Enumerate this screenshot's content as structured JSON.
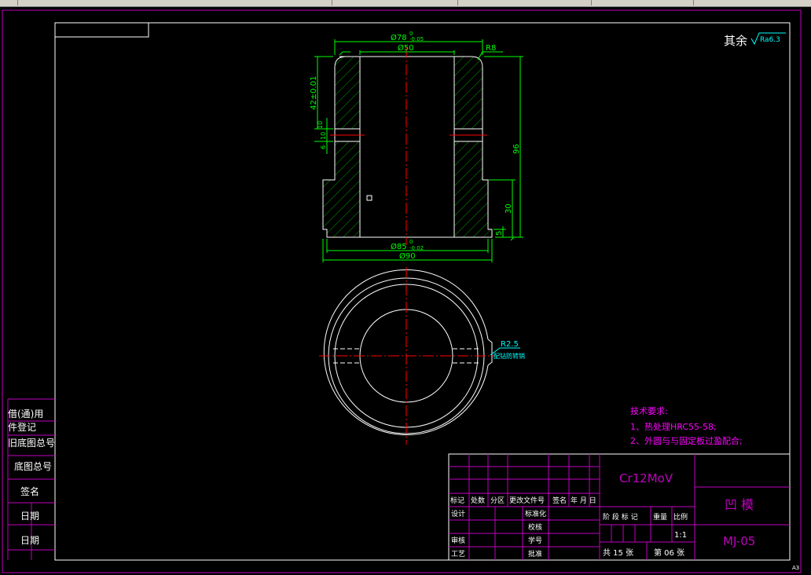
{
  "colors": {
    "background": "#000000",
    "frame": "#ffffff",
    "dimension": "#00ff00",
    "centerline": "#ff0000",
    "hatch": "#00b000",
    "title_block": "#c000c0",
    "notes": "#ff00ff",
    "annotation_cyan": "#00ffff"
  },
  "surface_finish_note": {
    "label": "其余",
    "roughness": "Ra6.3"
  },
  "front_view": {
    "dims": {
      "outer_top_base": "Ø78",
      "outer_top_upper": "0",
      "outer_top_lower": "-0.05",
      "inner": "Ø50",
      "fillet": "R8",
      "height_42": "42±0.01",
      "groove_dim_a": "6",
      "groove_dim_b": "10",
      "groove_dim_c": "10",
      "height_96": "96",
      "height_30": "30",
      "flange": "5",
      "bottom_base": "Ø85",
      "bottom_upper": "0",
      "bottom_lower": "-0.02",
      "overall": "Ø90"
    }
  },
  "top_view": {
    "radius_label": "R2.5",
    "pin_note": "配钻防转销"
  },
  "technical_requirements": {
    "title": "技术要求:",
    "items": [
      "1、热处理HRC55-58;",
      "2、外圆与与固定板过盈配合;"
    ]
  },
  "left_strip": {
    "labels": [
      "借(通)用",
      "件登记",
      "旧底图总号",
      "底图总号",
      "签名",
      "日期",
      "日期"
    ]
  },
  "title_block": {
    "material": "Cr12MoV",
    "part_name": "凹  模",
    "drawing_no": "MJ-05",
    "header_row": [
      "标记",
      "处数",
      "分区",
      "更改文件号",
      "签名",
      "年 月 日"
    ],
    "roles": {
      "design": "设计",
      "standard": "标准化",
      "check": "审核",
      "process": "工艺",
      "proofread": "校核",
      "craft": "学号",
      "approve": "批准"
    },
    "stage_labels": [
      "阶 段 标 记",
      "重量",
      "比例"
    ],
    "scale": "1:1",
    "sheets_total": "共 15 张",
    "sheet_no": "第 06 张"
  },
  "sheet_size": "A3"
}
